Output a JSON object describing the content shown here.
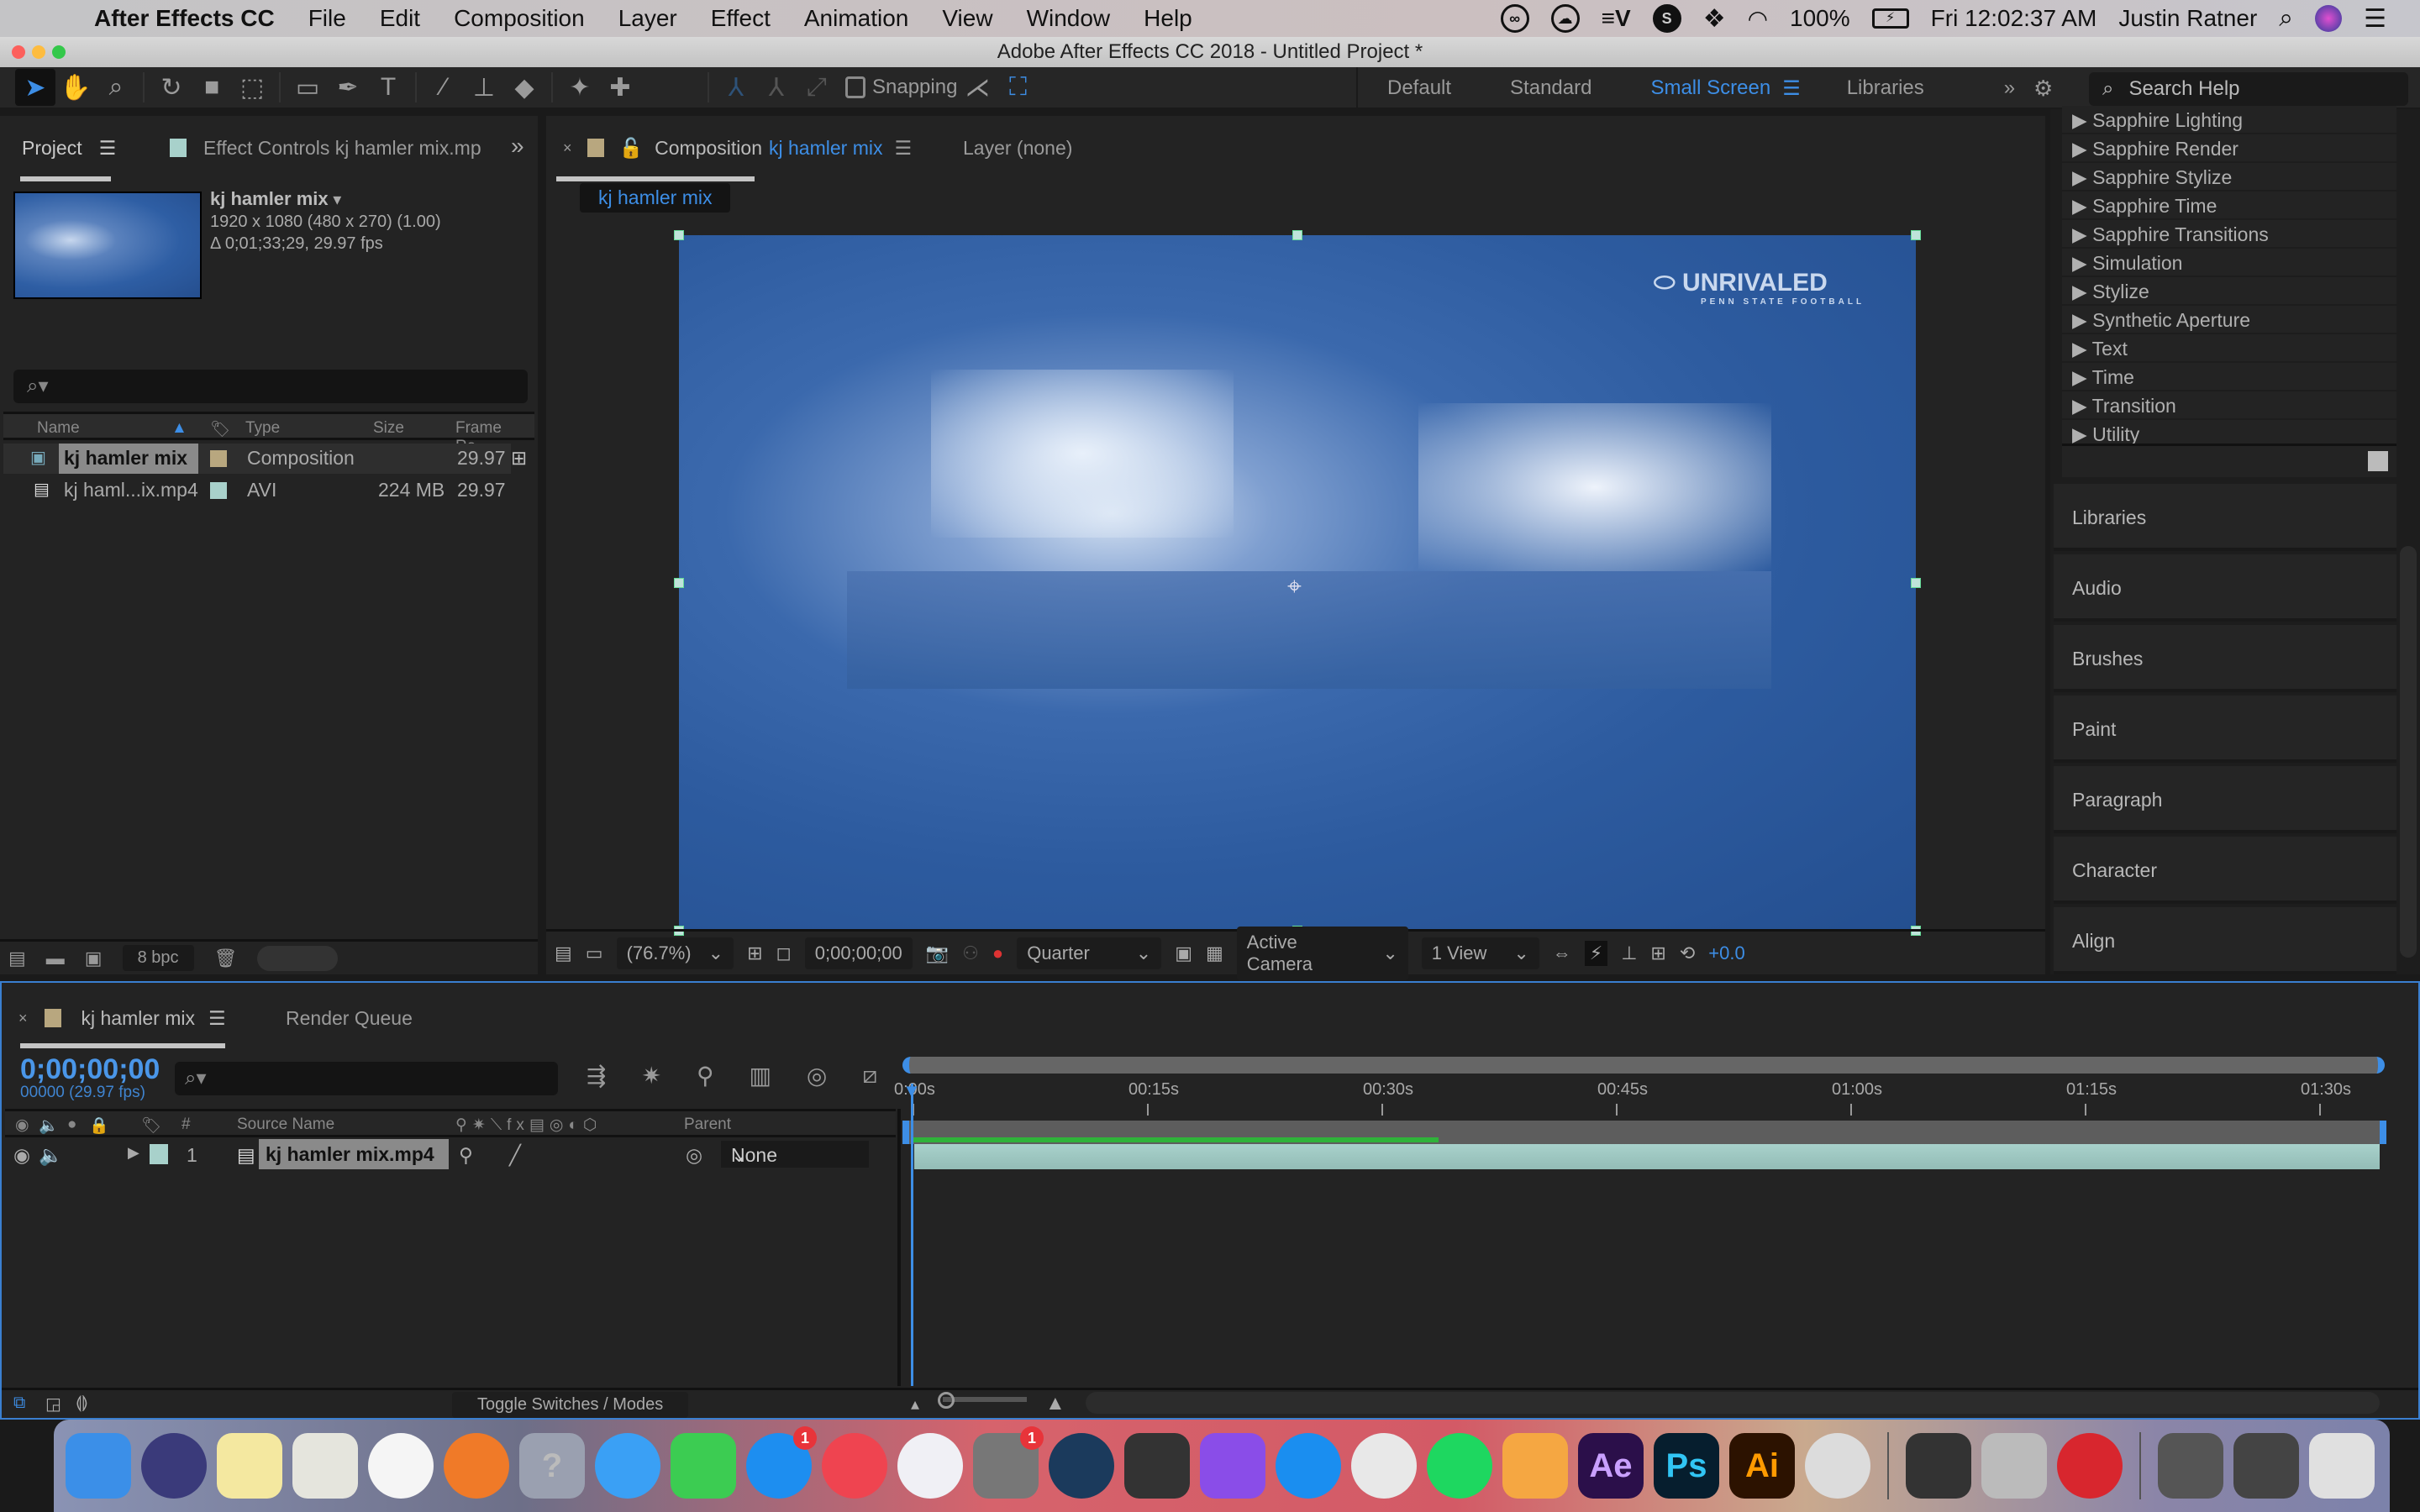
{
  "menubar": {
    "app_name": "After Effects CC",
    "items": [
      "File",
      "Edit",
      "Composition",
      "Layer",
      "Effect",
      "Animation",
      "View",
      "Window",
      "Help"
    ],
    "status_icons": [
      "creative-cloud-icon",
      "icloud-icon",
      "expressvpn-icon",
      "shazam-icon",
      "dropbox-icon",
      "wifi-icon"
    ],
    "battery": "100%",
    "clock": "Fri 12:02:37 AM",
    "user": "Justin Ratner"
  },
  "window": {
    "title": "Adobe After Effects CC 2018 - Untitled Project *"
  },
  "toolbar": {
    "snapping_label": "Snapping",
    "snapping_checked": false,
    "workspaces": [
      "Default",
      "Standard",
      "Small Screen",
      "Libraries"
    ],
    "active_workspace": "Small Screen",
    "search_placeholder": "Search Help"
  },
  "project": {
    "tab_label": "Project",
    "effect_controls_tab": "Effect Controls kj hamler mix.mp",
    "selected_name": "kj hamler mix",
    "selected_dims": "1920 x 1080  (480 x 270) (1.00)",
    "selected_duration": "Δ 0;01;33;29, 29.97 fps",
    "columns": [
      "Name",
      "Type",
      "Size",
      "Frame Ra..."
    ],
    "items": [
      {
        "name": "kj hamler mix",
        "label_color": "#b8a77f",
        "type": "Composition",
        "size": "",
        "frame_rate": "29.97",
        "selected": true
      },
      {
        "name": "kj haml...ix.mp4",
        "label_color": "#a8d1cb",
        "type": "AVI",
        "size": "224 MB",
        "frame_rate": "29.97",
        "selected": false
      }
    ],
    "bit_depth": "8 bpc"
  },
  "composition": {
    "tab_prefix": "Composition",
    "tab_name": "kj hamler mix",
    "layer_tab": "Layer (none)",
    "breadcrumb": "kj hamler mix",
    "overlay_logo": "UNRIVALED",
    "overlay_sub": "PENN STATE FOOTBALL",
    "zoom": "(76.7%)",
    "timecode": "0;00;00;00",
    "resolution": "Quarter",
    "camera": "Active Camera",
    "views": "1 View",
    "exposure": "+0.0"
  },
  "right_panel": {
    "effects_categories": [
      "Sapphire Lighting",
      "Sapphire Render",
      "Sapphire Stylize",
      "Sapphire Time",
      "Sapphire Transitions",
      "Simulation",
      "Stylize",
      "Synthetic Aperture",
      "Text",
      "Time",
      "Transition",
      "Utility"
    ],
    "panels": [
      "Libraries",
      "Audio",
      "Brushes",
      "Paint",
      "Paragraph",
      "Character",
      "Align"
    ]
  },
  "timeline": {
    "tab_label": "kj hamler mix",
    "render_queue_tab": "Render Queue",
    "current_time": "0;00;00;00",
    "frame_info": "00000 (29.97 fps)",
    "columns": {
      "num": "#",
      "source": "Source Name",
      "parent": "Parent"
    },
    "layers": [
      {
        "index": "1",
        "name": "kj hamler mix.mp4",
        "parent": "None",
        "label_color": "#a8d1cb"
      }
    ],
    "ruler_ticks": [
      "0:00s",
      "00:15s",
      "00:30s",
      "00:45s",
      "01:00s",
      "01:15s",
      "01:30s"
    ],
    "duration_seconds": 93.97,
    "cached_fraction": 0.36,
    "toggle_label": "Toggle Switches / Modes"
  },
  "dock": {
    "apps": [
      "Finder",
      "Siri",
      "Notes",
      "Maps",
      "Photos",
      "Firefox",
      "Unknown",
      "Messages",
      "FaceTime",
      "App Store",
      "News",
      "iTunes",
      "System Preferences",
      "Steam",
      "Final Cut",
      "iMovie",
      "Safari",
      "Chrome",
      "Spotify",
      "Pages",
      "After Effects",
      "Photoshop",
      "Illustrator",
      "Cinema 4D",
      "QuickTime",
      "System Information",
      "ExpressVPN",
      "Document 1",
      "Document 2",
      "Trash"
    ],
    "badges": {
      "App Store": "1",
      "System Preferences": "1"
    }
  },
  "colors": {
    "accent": "#3d8ee6",
    "panel": "#232323",
    "cache_bar": "#2fb33a",
    "layer_bar": "#a8d1cb"
  }
}
